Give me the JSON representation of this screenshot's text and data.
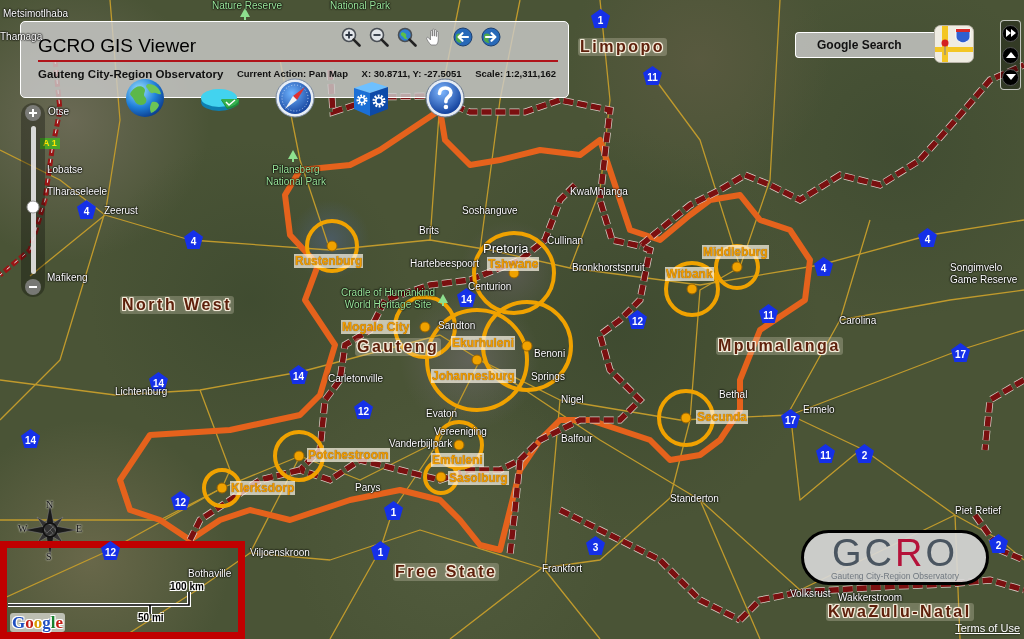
{
  "panel": {
    "title": "GCRO GIS Viewer",
    "subtitle": "Gauteng City-Region Observatory",
    "current_action": "Current Action: Pan Map",
    "coordinates": "X: 30.8711, Y: -27.5051",
    "scale": "Scale: 1:2,311,162",
    "tools": [
      {
        "kind": "zoom-in"
      },
      {
        "kind": "zoom-out"
      },
      {
        "kind": "zoom-extent"
      },
      {
        "kind": "pan"
      },
      {
        "kind": "back"
      },
      {
        "kind": "forward"
      }
    ],
    "big_tools": [
      {
        "kind": "globe"
      },
      {
        "kind": "pie"
      },
      {
        "kind": "compass"
      },
      {
        "kind": "settings"
      },
      {
        "kind": "help"
      }
    ]
  },
  "google_search": {
    "label": "Google Search"
  },
  "nav_buttons": [
    {
      "kind": "fast-forward"
    },
    {
      "kind": "up"
    },
    {
      "kind": "down"
    }
  ],
  "zoom_slider": {
    "level": 0.45
  },
  "map": {
    "provinces": [
      "Limpopo",
      "North West",
      "Gauteng",
      "Mpumalanga",
      "Free State",
      "KwaZulu-Natal"
    ],
    "parks": [
      "Nature Reserve",
      "National Park",
      "Pilansberg National Park",
      "Cradle of Humankind World Heritage Site"
    ],
    "places": [
      "Metsimotlhaba",
      "Thamaga",
      "Otse",
      "Lobatse",
      "Tlharaseleele",
      "Zeerust",
      "Mafikeng",
      "Lichtenburg",
      "Brits",
      "Soshanguve",
      "KwaMhlanga",
      "Cullinan",
      "Hartebeespoort",
      "Pretoria",
      "Centurion",
      "Bronkhorstspruit",
      "Sandton",
      "Benoni",
      "Springs",
      "Carletonville",
      "Nigel",
      "Evaton",
      "Vereeniging",
      "Vanderbijlpark",
      "Balfour",
      "Bethal",
      "Parys",
      "Viljoenskroon",
      "Bothaville",
      "Frankfort",
      "Standerton",
      "Volksrust",
      "Wakkerstroom",
      "Piet Retief",
      "Ermelo",
      "Carolina",
      "Songimvelo Game Reserve"
    ],
    "route_sign": "A 1",
    "road_shields": [
      "1",
      "11",
      "4",
      "4",
      "4",
      "4",
      "14",
      "14",
      "14",
      "14",
      "12",
      "12",
      "11",
      "17",
      "17",
      "11",
      "2",
      "2",
      "3",
      "12",
      "12",
      "1",
      "1"
    ],
    "municipalities": [
      "Rustenburg",
      "Tshwane",
      "Middleburg",
      "Witbank",
      "Mogale City",
      "Ekurhuleni",
      "Johannesburg",
      "Secunda",
      "Potchestroom",
      "Emfuleni",
      "Sasolburg",
      "Klerksdorp"
    ]
  },
  "compass_letters": [
    "N",
    "W",
    "E",
    "S"
  ],
  "scale_bar": {
    "metric": "100 km",
    "imperial": "50 mi"
  },
  "google_logo": "Google",
  "logo": {
    "acronym": "GCRO",
    "name": "Gauteng City-Region Observatory"
  },
  "terms_link": "Terms of Use"
}
